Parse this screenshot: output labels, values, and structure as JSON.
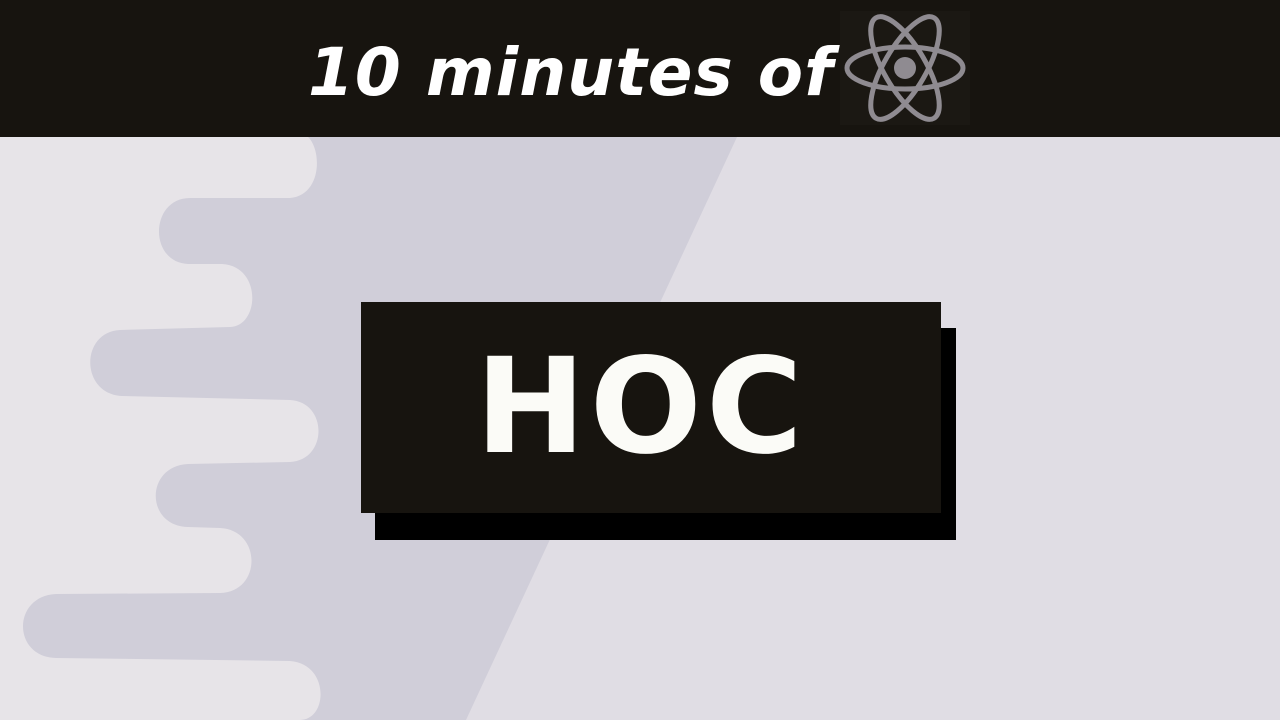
{
  "banner": {
    "headline": "10 minutes of",
    "logo_icon": "react-atom-icon"
  },
  "card": {
    "label": "HOC"
  },
  "colors": {
    "background": "#e0dde4",
    "drip_shape": "#d0ced9",
    "drip_highlight": "#e7e4e8",
    "bar": "#17140f",
    "text_light": "#fbfbf7",
    "logo_gray": "#8f8b91",
    "shadow": "#000000"
  }
}
